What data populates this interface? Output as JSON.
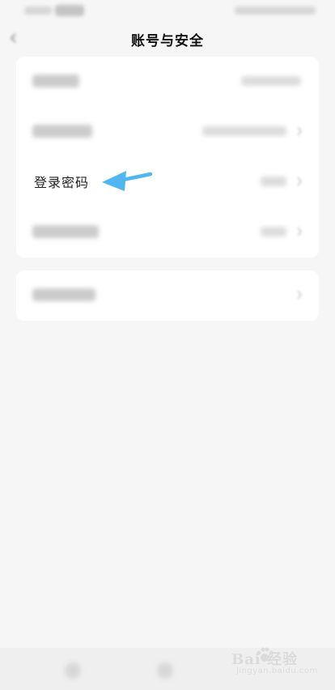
{
  "header": {
    "title": "账号与安全"
  },
  "security_list": {
    "login_password_label": "登录密码"
  },
  "watermark": {
    "brand": "Bai 经验",
    "url": "jingyan.baidu.com"
  },
  "colors": {
    "arrow": "#4fb6f0",
    "card_bg": "#ffffff",
    "page_bg": "#f6f6f6"
  },
  "icons": {
    "back": "back-arrow-icon",
    "chevron": "chevron-right-icon",
    "annotation": "annotation-arrow-icon"
  }
}
